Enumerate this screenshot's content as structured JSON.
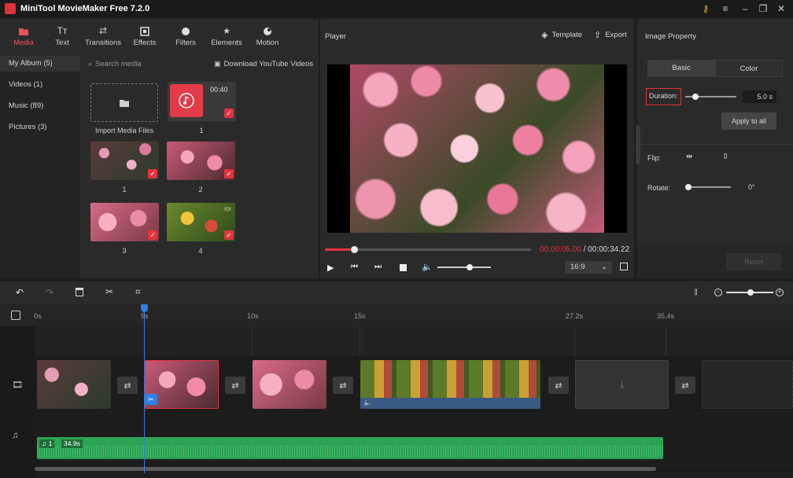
{
  "app": {
    "title": "MiniTool MovieMaker Free 7.2.0"
  },
  "media_tabs": [
    {
      "label": "Media"
    },
    {
      "label": "Text"
    },
    {
      "label": "Transitions"
    },
    {
      "label": "Effects"
    },
    {
      "label": "Filters"
    },
    {
      "label": "Elements"
    },
    {
      "label": "Motion"
    }
  ],
  "album": [
    {
      "label": "My Album (5)"
    },
    {
      "label": "Videos (1)"
    },
    {
      "label": "Music (89)"
    },
    {
      "label": "Pictures (3)"
    }
  ],
  "search": {
    "placeholder": "Search media",
    "download_label": "Download YouTube Videos"
  },
  "media_items": {
    "import_label": "Import Media Files",
    "music_duration": "00:40",
    "labels": [
      "1",
      "1",
      "2",
      "3",
      "4"
    ]
  },
  "player": {
    "title": "Player",
    "template_label": "Template",
    "export_label": "Export",
    "current_time": "00:00:05.00",
    "separator": " / ",
    "total_time": "00:00:34.22",
    "aspect": "16:9",
    "progress": 0.142,
    "volume": 0.6
  },
  "props": {
    "title": "Image Property",
    "tab_basic": "Basic",
    "tab_color": "Color",
    "duration_label": "Duration:",
    "duration_value": "5.0 s",
    "apply_all": "Apply to all",
    "flip_label": "Flip:",
    "rotate_label": "Rotate:",
    "rotate_value": "0°",
    "reset": "Reset"
  },
  "timeline": {
    "ticks": [
      "0s",
      "5s",
      "10s",
      "15s",
      "27.2s",
      "35.4s"
    ],
    "audio_index": "1",
    "audio_duration": "34.9s"
  },
  "colors": {
    "accent": "#e4323e",
    "playhead": "#2f7fe0",
    "audio": "#2ea556"
  }
}
